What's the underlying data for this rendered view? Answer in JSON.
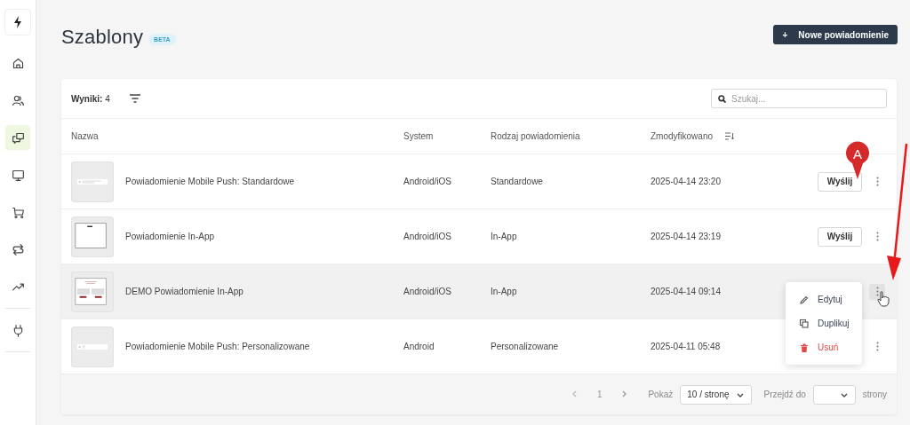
{
  "sidebar": {
    "items": [
      {
        "kind": "home",
        "selected": false
      },
      {
        "kind": "users",
        "selected": false
      },
      {
        "kind": "messages",
        "selected": true
      },
      {
        "kind": "monitor",
        "selected": false
      },
      {
        "kind": "cart",
        "selected": false
      },
      {
        "kind": "flows",
        "selected": false
      },
      {
        "kind": "trend",
        "selected": false
      },
      {
        "kind": "plug",
        "selected": false
      }
    ]
  },
  "header": {
    "title": "Szablony",
    "badge": "BETA",
    "new_button": {
      "icon": "+",
      "label": "Nowe powiadomienie"
    }
  },
  "toolbar": {
    "results_label": "Wyniki:",
    "results_count": "4",
    "search": {
      "placeholder": "Szukaj..."
    }
  },
  "table": {
    "columns": [
      {
        "label": "Nazwa",
        "sortable": false
      },
      {
        "label": "System",
        "sortable": false
      },
      {
        "label": "Rodzaj powiadomienia",
        "sortable": false
      },
      {
        "label": "Zmodyfikowano",
        "sortable": true
      }
    ],
    "rows": [
      {
        "thumbnail": {
          "kind": "push"
        },
        "name": "Powiadomienie Mobile Push: Standardowe",
        "system": "Android/iOS",
        "type": "Standardowe",
        "modified": "2025-04-14 23:20",
        "send": "Wyślij",
        "hovered": false,
        "menu_open": false
      },
      {
        "thumbnail": {
          "kind": "inapp"
        },
        "name": "Powiadomienie In-App",
        "system": "Android/iOS",
        "type": "In-App",
        "modified": "2025-04-14 23:19",
        "send": "Wyślij",
        "hovered": false,
        "menu_open": false
      },
      {
        "thumbnail": {
          "kind": "inapp-demo"
        },
        "name": "DEMO Powiadomienie In-App",
        "system": "Android/iOS",
        "type": "In-App",
        "modified": "2025-04-14 09:14",
        "hovered": true,
        "menu_open": true
      },
      {
        "thumbnail": {
          "kind": "push-small"
        },
        "name": "Powiadomienie Mobile Push: Personalizowane",
        "system": "Android",
        "type": "Personalizowane",
        "modified": "2025-04-11 05:48",
        "hovered": false,
        "menu_open": false
      }
    ]
  },
  "row_menu": {
    "items": [
      {
        "kind": "edit",
        "label": "Edytuj"
      },
      {
        "kind": "duplicate",
        "label": "Duplikuj"
      },
      {
        "kind": "delete",
        "label": "Usuń"
      }
    ]
  },
  "pagination": {
    "page": "1",
    "show_label": "Pokaż",
    "page_size": "10 / stronę",
    "goto_label": "Przejdź do",
    "pages_suffix": "strony"
  },
  "annotation": {
    "marker_label": "A"
  }
}
